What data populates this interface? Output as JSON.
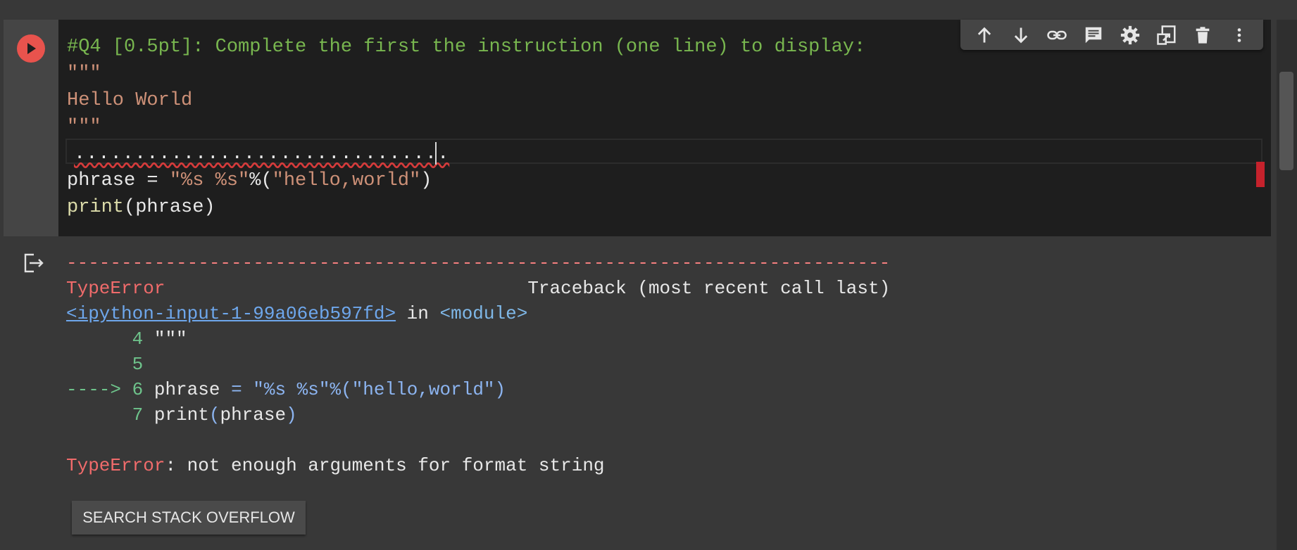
{
  "code_cell": {
    "lines": [
      {
        "text": "#Q4 [0.5pt]: Complete the first the instruction (one line) to display:"
      },
      {
        "text": "\"\"\""
      },
      {
        "text": "Hello World"
      },
      {
        "text": "\"\"\""
      },
      {
        "text": "..............................."
      },
      {
        "p1": "phrase = ",
        "p2": "\"%s %s\"",
        "p3": "%(",
        "p4": "\"hello,world\"",
        "p5": ")"
      },
      {
        "p1": "print",
        "p2": "(phrase)"
      }
    ]
  },
  "toolbar": {
    "items": [
      {
        "icon": "arrow-up-icon",
        "label": "Move cell up"
      },
      {
        "icon": "arrow-down-icon",
        "label": "Move cell down"
      },
      {
        "icon": "link-icon",
        "label": "Link to cell"
      },
      {
        "icon": "comment-icon",
        "label": "Add comment"
      },
      {
        "icon": "gear-icon",
        "label": "Settings"
      },
      {
        "icon": "mirror-cell-icon",
        "label": "Mirror cell in tab"
      },
      {
        "icon": "trash-icon",
        "label": "Delete cell"
      },
      {
        "icon": "more-vert-icon",
        "label": "More cell actions"
      }
    ]
  },
  "output": {
    "separator": "---------------------------------------------------------------------------",
    "error_type": "TypeError",
    "traceback_label": "Traceback (most recent call last)",
    "traceback_pad": "                                 ",
    "input_link": "<ipython-input-1-99a06eb597fd>",
    "in_word": " in ",
    "module": "<module>",
    "tb_lines": [
      {
        "prefix": "      ",
        "num": "4",
        "code_a": " \"\"\""
      },
      {
        "prefix": "      ",
        "num": "5",
        "code_a": ""
      },
      {
        "prefix": "----> ",
        "num": "6",
        "code_a": " phrase ",
        "code_b": "=",
        "code_c": " \"%s %s\"%(\"hello,world\")"
      },
      {
        "prefix": "      ",
        "num": "7",
        "code_a": " print",
        "code_b": "(",
        "code_c": "phrase",
        "code_d": ")"
      }
    ],
    "error_message": ": not enough arguments for format string",
    "so_button": "SEARCH STACK OVERFLOW"
  }
}
